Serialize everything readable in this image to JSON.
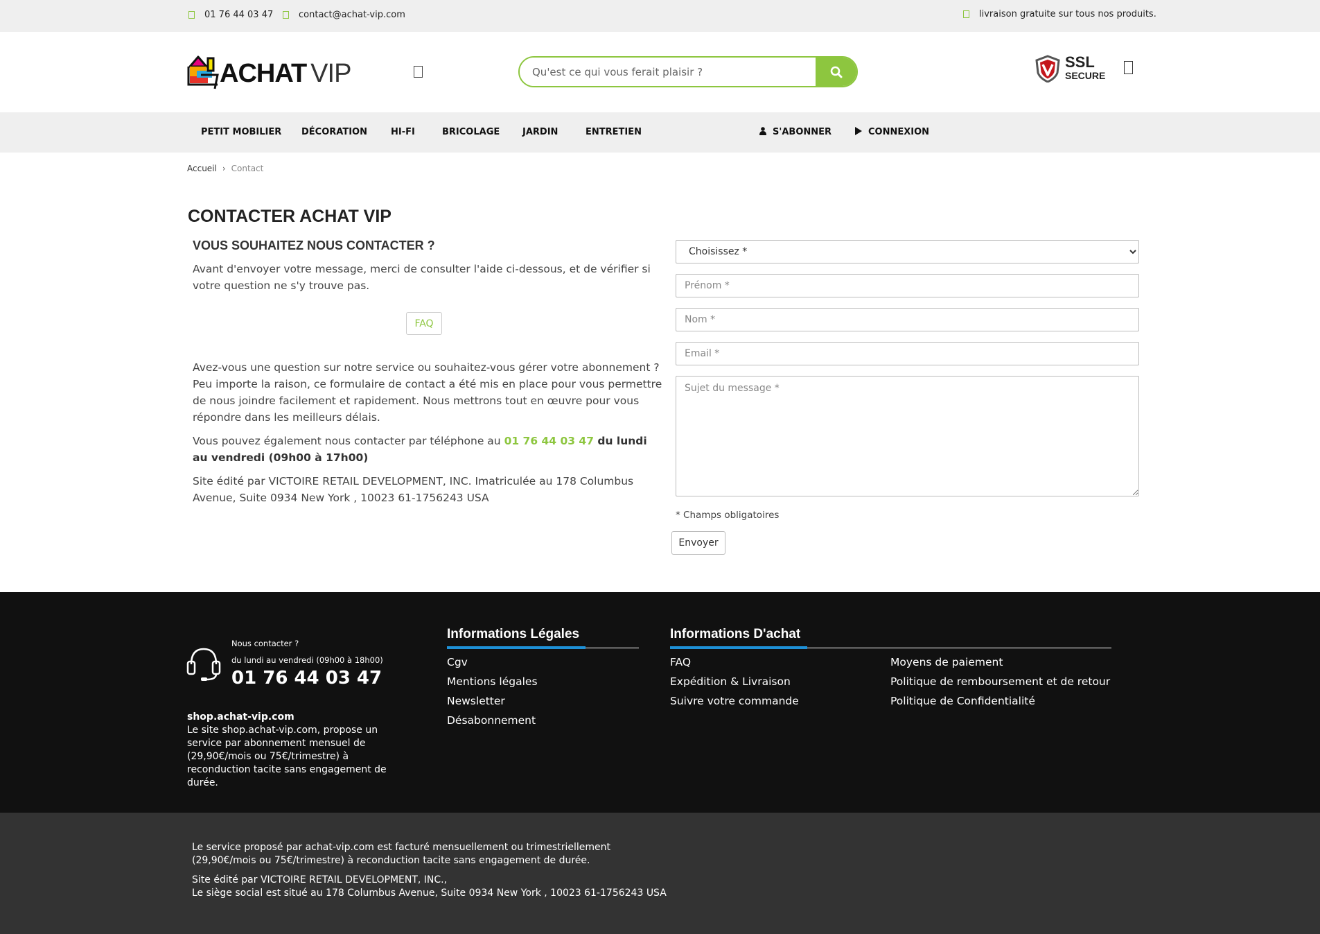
{
  "topbar": {
    "phone": "01 76 44 03 47",
    "email": "contact@achat-vip.com",
    "shipping": "livraison gratuite sur tous nos produits."
  },
  "header": {
    "logo_main": "ACHAT",
    "logo_vip": "VIP",
    "search_placeholder": "Qu'est ce qui vous ferait plaisir ?",
    "ssl_big": "SSL",
    "ssl_small": "SECURE"
  },
  "nav": {
    "items": [
      "PETIT MOBILIER",
      "DÉCORATION",
      "HI-FI",
      "BRICOLAGE",
      "JARDIN",
      "ENTRETIEN"
    ],
    "subscribe": "S'ABONNER",
    "login": "CONNEXION"
  },
  "breadcrumb": {
    "home": "Accueil",
    "separator": "›",
    "current": "Contact"
  },
  "content": {
    "title": "CONTACTER ACHAT VIP",
    "subtitle": "VOUS SOUHAITEZ NOUS CONTACTER ?",
    "intro": "Avant d'envoyer votre message, merci de consulter l'aide ci-dessous, et de vérifier si votre question ne s'y trouve pas.",
    "faq_button": "FAQ",
    "body": "Avez-vous une question sur notre service ou souhaitez-vous gérer votre abonnement ? Peu importe la raison, ce formulaire de contact a été mis en place pour vous permettre de nous joindre facilement et rapidement. Nous mettrons tout en œuvre pour vous répondre dans les meilleurs délais.",
    "phone_prefix": "Vous pouvez également nous contacter par téléphone au ",
    "phone": "01 76 44 03 47",
    "phone_hours": " du lundi au vendredi (09h00 à 17h00)",
    "editor": "Site édité par VICTOIRE RETAIL DEVELOPMENT, INC. Imatriculée au 178 Columbus Avenue, Suite 0934 New York , 10023 61-1756243 USA"
  },
  "form": {
    "select_value": "Choisissez *",
    "firstname_placeholder": "Prénom *",
    "lastname_placeholder": "Nom *",
    "email_placeholder": "Email *",
    "message_placeholder": "Sujet du message *",
    "required_note": "* Champs obligatoires",
    "submit": "Envoyer"
  },
  "footer": {
    "contact_label": "Nous contacter ?",
    "contact_hours": "du lundi au vendredi (09h00 à 18h00)",
    "contact_phone": "01 76 44 03 47",
    "site_name": "shop.achat-vip.com",
    "site_desc": "Le site shop.achat-vip.com, propose un service par abonnement mensuel de (29,90€/mois ou 75€/trimestre) à reconduction tacite sans engagement de durée.",
    "legal_title": "Informations Légales",
    "legal_links": [
      "Cgv",
      "Mentions légales",
      "Newsletter",
      "Désabonnement"
    ],
    "purchase_title": "Informations D'achat",
    "purchase_links_col1": [
      "FAQ",
      "Expédition & Livraison",
      "Suivre votre commande"
    ],
    "purchase_links_col2": [
      "Moyens de paiement",
      "Politique de remboursement et de retour",
      "Politique de Confidentialité"
    ]
  },
  "bottom": {
    "billing": "Le service proposé par achat-vip.com est facturé mensuellement ou trimestriellement (29,90€/mois ou 75€/trimestre) à reconduction tacite sans engagement de durée.",
    "editor": "Site édité par VICTOIRE RETAIL DEVELOPMENT, INC.,",
    "address": "Le siège social est situé au 178 Columbus Avenue, Suite 0934 New York , 10023 61-1756243 USA"
  },
  "colors": {
    "accent_green": "#8dc63f",
    "footer_bg": "#111111",
    "bottom_bg": "#333333",
    "footer_accent_blue": "#1e90d6",
    "topbar_bg": "#efefef"
  },
  "icons": [
    "phone-icon",
    "mail-icon",
    "truck-icon",
    "menu-icon",
    "search-icon",
    "ssl-shield-icon",
    "cart-icon",
    "user-icon",
    "play-icon",
    "headset-icon"
  ]
}
